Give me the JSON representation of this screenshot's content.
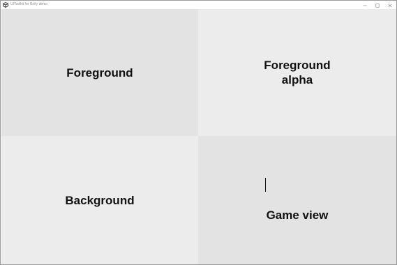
{
  "window": {
    "title": "UIToolkit for Unity demo",
    "controls": {
      "minimize_icon": "minimize-icon",
      "maximize_icon": "maximize-icon",
      "close_icon": "close-icon"
    }
  },
  "panels": [
    {
      "label": "Foreground"
    },
    {
      "label": "Foreground\nalpha"
    },
    {
      "label": "Background"
    },
    {
      "label": "Game view"
    }
  ],
  "colors": {
    "panel_dark": "#e3e3e3",
    "panel_light": "#ececec",
    "text": "#111111"
  }
}
